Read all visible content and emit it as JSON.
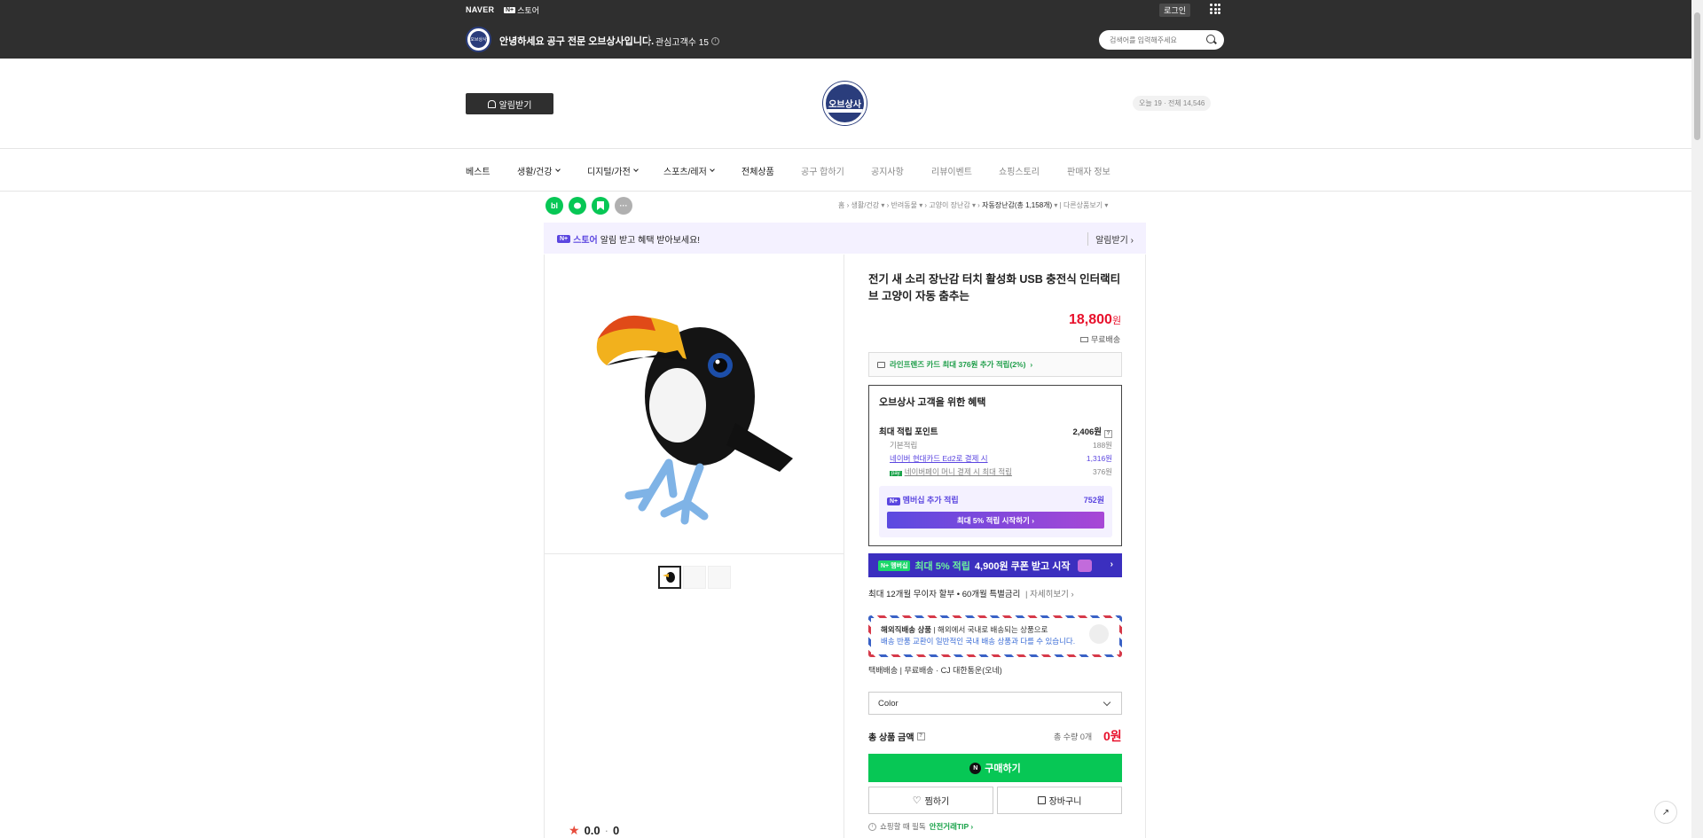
{
  "topbar": {
    "naver": "NAVER",
    "nstore_badge": "N+",
    "nstore_label": "스토어",
    "login": "로그인",
    "greeting": "안녕하세요 공구 전문 오브상사입니다.",
    "interest_label": "관심고객수 15",
    "search_placeholder": "검색어를 입력해주세요",
    "store_avatar_text": "오브상사"
  },
  "header": {
    "notify_button": "알림받기",
    "logo_text": "오브상사",
    "visitors": "오늘 19 · 전체 14,546"
  },
  "nav": {
    "items": [
      {
        "label": "베스트"
      },
      {
        "label": "생활/건강"
      },
      {
        "label": "디지털/가전"
      },
      {
        "label": "스포츠/레저"
      },
      {
        "label": "전체상품"
      },
      {
        "label": "공구 합하기"
      },
      {
        "label": "공지사항"
      },
      {
        "label": "리뷰이벤트"
      },
      {
        "label": "쇼핑스토리"
      },
      {
        "label": "판매자 정보"
      }
    ]
  },
  "share": {
    "blog": "bl",
    "talk": "",
    "bookmark": "",
    "more": "···"
  },
  "breadcrumb": {
    "home": "홈",
    "c1": "생활/건강",
    "c2": "반려동물",
    "c3": "고양이 장난감",
    "c4": "자동장난감(총 1,158개)",
    "other": "다른상품보기"
  },
  "alarm_banner": {
    "badge": "N+",
    "store": "스토어",
    "text": "알림 받고 혜택 받아보세요!",
    "right": "알림받기"
  },
  "product": {
    "title": "전기 새 소리 장난감 터치 활성화 USB 충전식 인터랙티브 고양이 자동 춤추는",
    "price": "18,800",
    "price_unit": "원",
    "shipping": "무료배송",
    "card_benefit": "라인프렌즈 카드 최대 376원 추가 적립(2%)",
    "rating": "0.0",
    "review_count": "0"
  },
  "benefit": {
    "title": "오브상사 고객을 위한 혜택",
    "max_points_label": "최대 적립 포인트",
    "max_points_value": "2,406원",
    "rows": [
      {
        "label": "기본적립",
        "value": "188원"
      },
      {
        "label": "네이버 현대카드 Ed2로 결제 시",
        "value": "1,316원"
      },
      {
        "label": "네이버페이 머니 결제 시 최대 적립",
        "value": "376원"
      }
    ],
    "np_badge": "pay",
    "membership_label": "멤버십 추가 적립",
    "membership_value": "752원",
    "membership_button": "최대 5% 적립 시작하기"
  },
  "promo": {
    "badge": "N+ 멤버십",
    "text_green": "최대 5% 적립",
    "text_white": "4,900원 쿠폰 받고 시작"
  },
  "installment": {
    "text": "최대 12개월 무이자 할부 • 60개월 특별금리",
    "more": "자세히보기"
  },
  "overseas": {
    "title": "해외직배송 상품",
    "desc": "해외에서 국내로 배송되는 상품으로",
    "desc2": "배송 반품 교환이 일반적인 국내 배송 상품과 다를 수 있습니다."
  },
  "delivery": {
    "text": "택배배송 | 무료배송 · CJ 대한통운(오네)"
  },
  "options": {
    "color_placeholder": "Color"
  },
  "total": {
    "label": "총 상품 금액",
    "qty": "총 수량 0개",
    "price": "0원"
  },
  "actions": {
    "buy": "구매하기",
    "wish": "찜하기",
    "cart": "장바구니"
  },
  "safe": {
    "text": "쇼핑할 때 필독",
    "tip": "안전거래TIP"
  },
  "colors": {
    "topbar": "#2f2f2f",
    "brand_navy": "#2a3d7c",
    "price_red": "#e8102b",
    "naver_green": "#07c755",
    "membership_purple": "#5b46e0"
  }
}
